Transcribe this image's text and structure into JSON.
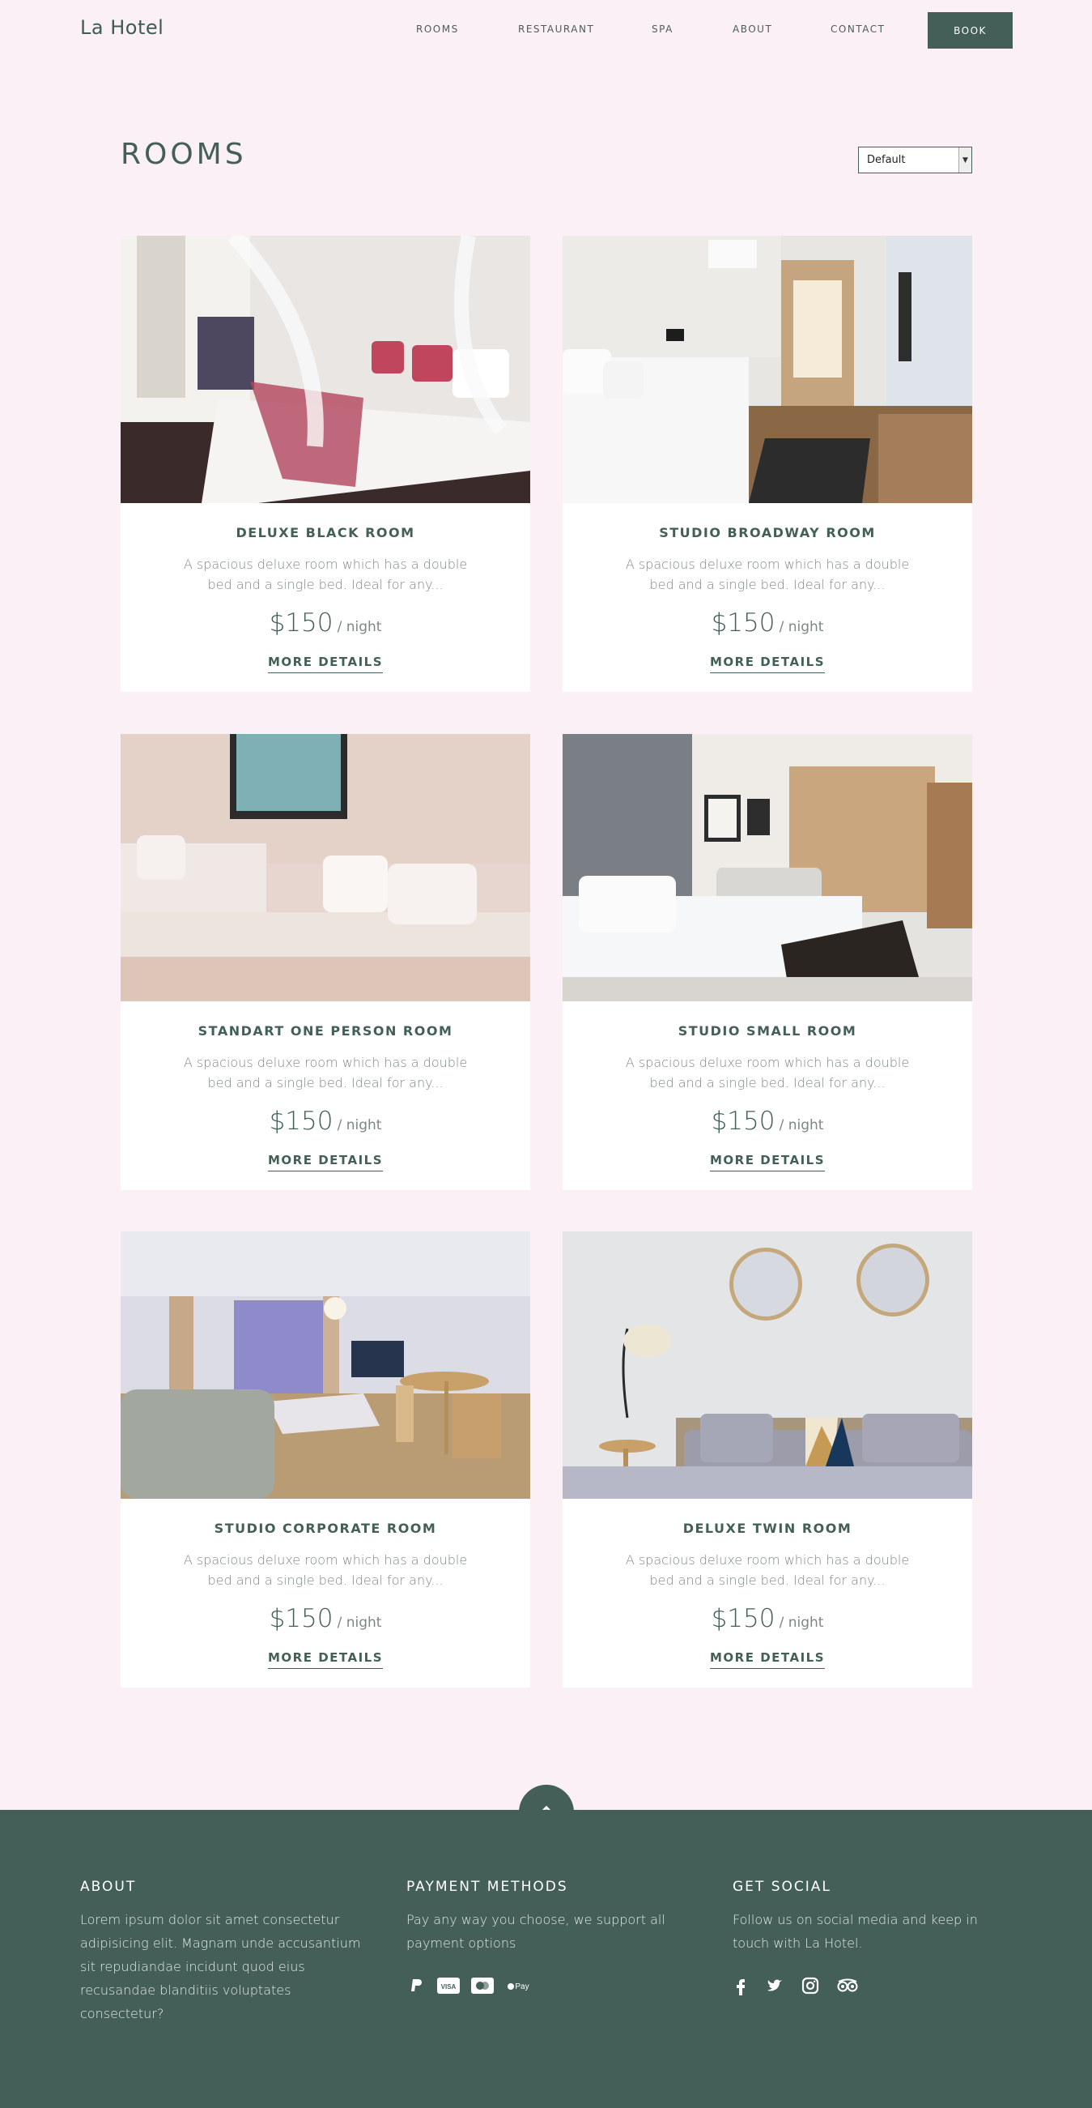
{
  "nav": {
    "brand": "La Hotel",
    "links": [
      "ROOMS",
      "RESTAURANT",
      "SPA",
      "ABOUT",
      "CONTACT"
    ],
    "book_label": "BOOK"
  },
  "header": {
    "title": "ROOMS",
    "sort_value": "Default"
  },
  "rooms": [
    {
      "title": "DELUXE BLACK ROOM",
      "desc": "A spacious deluxe room which has a double bed and a single bed. Ideal for any...",
      "price": "$150",
      "unit": "/ night",
      "link": "MORE DETAILS"
    },
    {
      "title": "STUDIO BROADWAY ROOM",
      "desc": "A spacious deluxe room which has a double bed and a single bed. Ideal for any...",
      "price": "$150",
      "unit": "/ night",
      "link": "MORE DETAILS"
    },
    {
      "title": "STANDART ONE PERSON ROOM",
      "desc": "A spacious deluxe room which has a double bed and a single bed. Ideal for any...",
      "price": "$150",
      "unit": "/ night",
      "link": "MORE DETAILS"
    },
    {
      "title": "STUDIO SMALL ROOM",
      "desc": "A spacious deluxe room which has a double bed and a single bed. Ideal for any...",
      "price": "$150",
      "unit": "/ night",
      "link": "MORE DETAILS"
    },
    {
      "title": "STUDIO CORPORATE ROOM",
      "desc": "A spacious deluxe room which has a double bed and a single bed. Ideal for any...",
      "price": "$150",
      "unit": "/ night",
      "link": "MORE DETAILS"
    },
    {
      "title": "DELUXE TWIN ROOM",
      "desc": "A spacious deluxe room which has a double bed and a single bed. Ideal for any...",
      "price": "$150",
      "unit": "/ night",
      "link": "MORE DETAILS"
    }
  ],
  "footer": {
    "about_title": "ABOUT",
    "about_text": "Lorem ipsum dolor sit amet consectetur adipisicing elit. Magnam unde accusantium sit repudiandae incidunt quod eius recusandae blanditiis voluptates consectetur?",
    "payment_title": "PAYMENT METHODS",
    "payment_text": "Pay any way you choose, we support all payment options",
    "payment_icons": [
      "paypal-icon",
      "visa-icon",
      "mastercard-icon",
      "apple-pay-icon"
    ],
    "visa_label": "VISA",
    "applepay_label": "Pay",
    "social_title": "GET SOCIAL",
    "social_text": "Follow us on social media and keep in touch with La Hotel.",
    "social_icons": [
      "facebook-icon",
      "twitter-icon",
      "instagram-icon",
      "tripadvisor-icon"
    ]
  }
}
